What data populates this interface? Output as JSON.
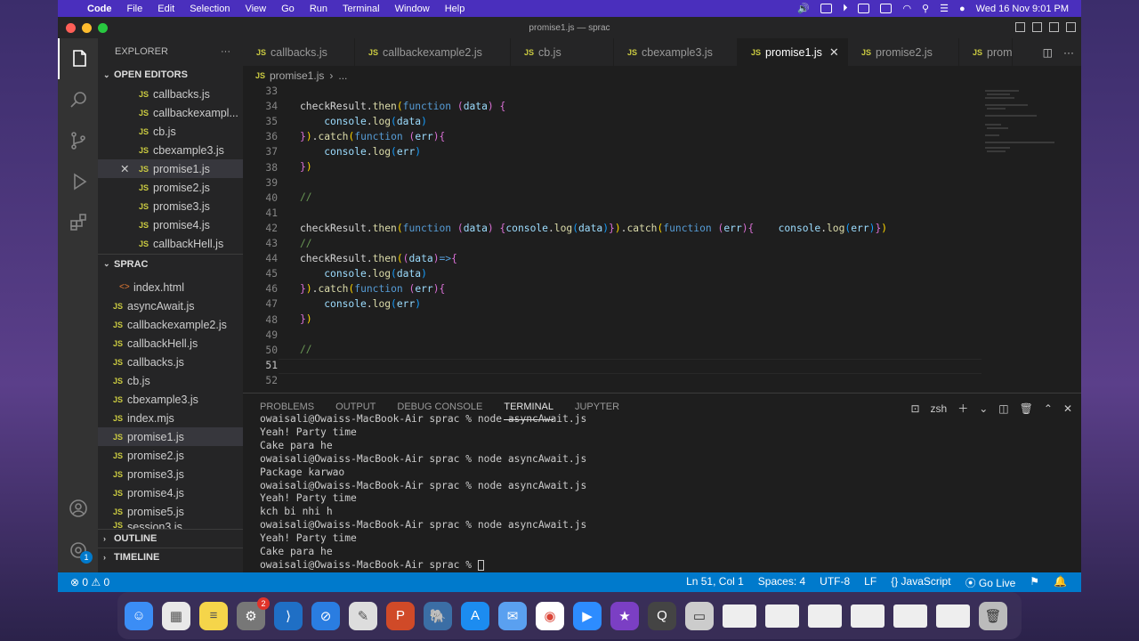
{
  "menubar": {
    "app": "Code",
    "items": [
      "File",
      "Edit",
      "Selection",
      "View",
      "Go",
      "Run",
      "Terminal",
      "Window",
      "Help"
    ],
    "clock": "Wed 16 Nov  9:01 PM"
  },
  "window": {
    "title": "promise1.js — sprac"
  },
  "sidebar": {
    "explorer_label": "EXPLORER",
    "open_editors_label": "OPEN EDITORS",
    "open_editors": [
      "callbacks.js",
      "callbackexampl...",
      "cb.js",
      "cbexample3.js",
      "promise1.js",
      "promise2.js",
      "promise3.js",
      "promise4.js",
      "callbackHell.js"
    ],
    "workspace_label": "SPRAC",
    "files": [
      "index.html",
      "asyncAwait.js",
      "callbackexample2.js",
      "callbackHell.js",
      "callbacks.js",
      "cb.js",
      "cbexample3.js",
      "index.mjs",
      "promise1.js",
      "promise2.js",
      "promise3.js",
      "promise4.js",
      "promise5.js",
      "session3.js"
    ],
    "outline_label": "OUTLINE",
    "timeline_label": "TIMELINE",
    "badge": "1"
  },
  "tabs": [
    "callbacks.js",
    "callbackexample2.js",
    "cb.js",
    "cbexample3.js",
    "promise1.js",
    "promise2.js",
    "promise"
  ],
  "breadcrumb": {
    "file": "promise1.js",
    "rest": "..."
  },
  "editor": {
    "line_numbers": [
      "33",
      "34",
      "35",
      "36",
      "37",
      "38",
      "39",
      "40",
      "41",
      "42",
      "43",
      "44",
      "45",
      "46",
      "47",
      "48",
      "49",
      "50",
      "51",
      "52"
    ]
  },
  "panel": {
    "tabs": [
      "PROBLEMS",
      "OUTPUT",
      "DEBUG CONSOLE",
      "TERMINAL",
      "JUPYTER"
    ],
    "shell": "zsh",
    "terminal_lines": [
      "owaisali@Owaiss-MacBook-Air sprac % node asyncAwait.js",
      "Yeah! Party time",
      "Cake para he",
      "owaisali@Owaiss-MacBook-Air sprac % node asyncAwait.js",
      "Package karwao",
      "owaisali@Owaiss-MacBook-Air sprac % node asyncAwait.js",
      "Yeah! Party time",
      "kch bi nhi h",
      "owaisali@Owaiss-MacBook-Air sprac % node asyncAwait.js",
      "Yeah! Party time",
      "Cake para he"
    ],
    "prompt": "owaisali@Owaiss-MacBook-Air sprac % "
  },
  "status": {
    "errors": "0",
    "warnings": "0",
    "position": "Ln 51, Col 1",
    "spaces": "Spaces: 4",
    "encoding": "UTF-8",
    "eol": "LF",
    "language": "JavaScript",
    "golive": "Go Live"
  },
  "dock": {
    "settings_badge": "2"
  }
}
